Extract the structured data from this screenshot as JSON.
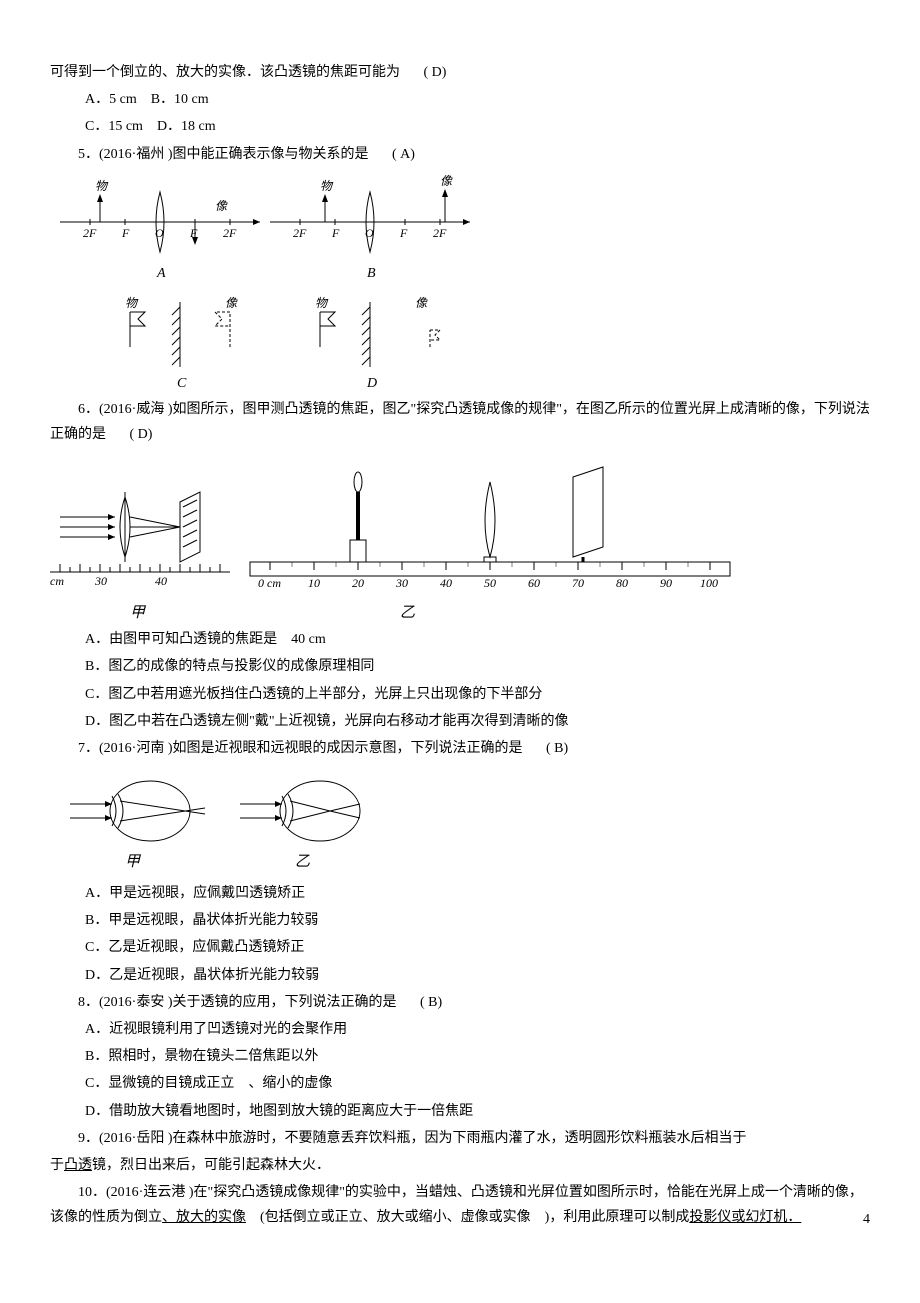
{
  "intro_line": "可得到一个倒立的、放大的实像．该凸透镜的焦距可能为",
  "intro_answer": "( D)",
  "q4_options_line1": "A．5 cm　B．10 cm",
  "q4_options_line2": "C．15 cm　D．18 cm",
  "q5": {
    "text": "5．(2016·福州 )图中能正确表示像与物关系的是",
    "answer": "( A)",
    "diagram": {
      "obj": "物",
      "img": "像",
      "labels": [
        "2F",
        "F",
        "O",
        "F",
        "2F"
      ],
      "A": "A",
      "B": "B",
      "C": "C",
      "D": "D"
    }
  },
  "q6": {
    "text": "6．(2016·威海 )如图所示，图甲测凸透镜的焦距，图乙\"探究凸透镜成像的规律\"，在图乙所示的位置光屏上成清晰的像，下列说法正确的是",
    "answer": "( D)",
    "diagram": {
      "jia": "甲",
      "yi": "乙",
      "cm": "cm",
      "ruler1": [
        "30",
        "40"
      ],
      "ruler2": [
        "0 cm",
        "10",
        "20",
        "30",
        "40",
        "50",
        "60",
        "70",
        "80",
        "90",
        "100"
      ]
    },
    "optA": "A．由图甲可知凸透镜的焦距是　40 cm",
    "optB": "B．图乙的成像的特点与投影仪的成像原理相同",
    "optC": "C．图乙中若用遮光板挡住凸透镜的上半部分，光屏上只出现像的下半部分",
    "optD": "D．图乙中若在凸透镜左侧\"戴\"上近视镜，光屏向右移动才能再次得到清晰的像"
  },
  "q7": {
    "text": "7．(2016·河南 )如图是近视眼和远视眼的成因示意图，下列说法正确的是",
    "answer": "( B)",
    "diagram": {
      "jia": "甲",
      "yi": "乙"
    },
    "optA": "A．甲是远视眼，应佩戴凹透镜矫正",
    "optB": "B．甲是远视眼，晶状体折光能力较弱",
    "optC": "C．乙是近视眼，应佩戴凸透镜矫正",
    "optD": "D．乙是近视眼，晶状体折光能力较弱"
  },
  "q8": {
    "text": "8．(2016·泰安 )关于透镜的应用，下列说法正确的是",
    "answer": "( B)",
    "optA": "A．近视眼镜利用了凹透镜对光的会聚作用",
    "optB": "B．照相时，景物在镜头二倍焦距以外",
    "optC": "C．显微镜的目镜成正立　、缩小的虚像",
    "optD": "D．借助放大镜看地图时，地图到放大镜的距离应大于一倍焦距"
  },
  "q9": {
    "text_a": "9．(2016·岳阳 )在森林中旅游时，不要随意丢弃饮料瓶，因为下雨瓶内灌了水，透明圆形饮料瓶装水后相当于",
    "underline1": "凸透",
    "text_b": "镜，烈日出来后，可能引起森林大火．"
  },
  "q10": {
    "text_a": "10．(2016·连云港 )在\"探究凸透镜成像规律\"的实验中，当蜡烛、凸透镜和光屏位置如图所示时，恰能在光屏上成一个清晰的像，该像的性质为倒立",
    "underline1": "、放大的实像",
    "text_b": "(包括倒立或正立、放大或缩小、虚像或实像　)，利用此原理可以制成",
    "underline2": "投影仪或幻灯机．"
  },
  "page_num": "4"
}
